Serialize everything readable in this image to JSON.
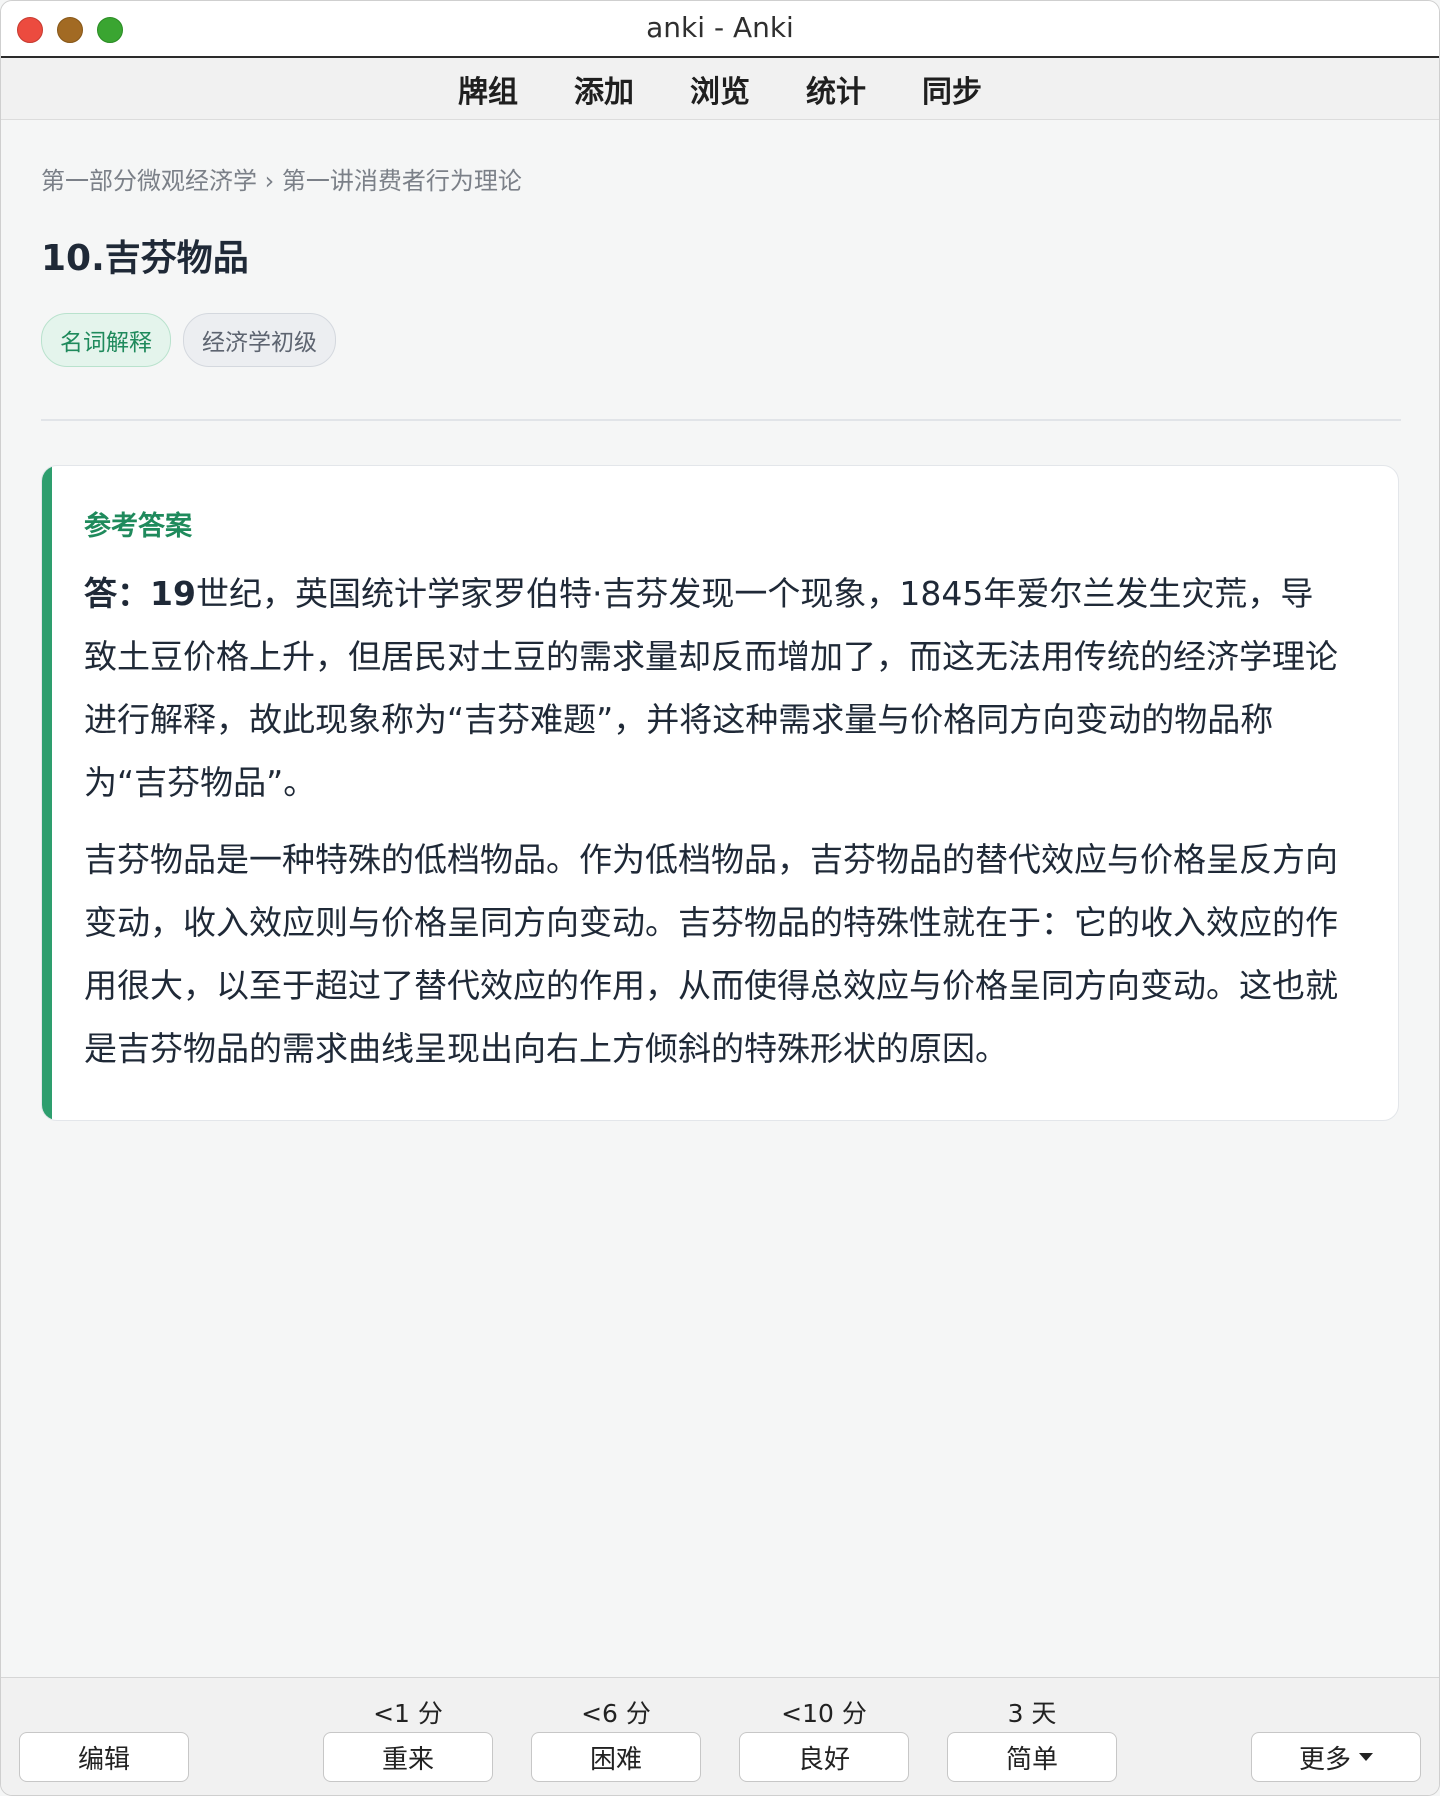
{
  "window": {
    "title": "anki - Anki"
  },
  "topnav": {
    "items": [
      "牌组",
      "添加",
      "浏览",
      "统计",
      "同步"
    ]
  },
  "breadcrumb": "第一部分微观经济学 › 第一讲消费者行为理论",
  "card": {
    "title": "10.吉芬物品",
    "tags": [
      "名词解释",
      "经济学初级"
    ],
    "answer_label": "参考答案",
    "answer_lead": "答：19",
    "answer_p1_rest": "世纪，英国统计学家罗伯特·吉芬发现一个现象，1845年爱尔兰发生灾荒，导致土豆价格上升，但居民对土豆的需求量却反而增加了，而这无法用传统的经济学理论进行解释，故此现象称为“吉芬难题”，并将这种需求量与价格同方向变动的物品称为“吉芬物品”。",
    "answer_p2": "吉芬物品是一种特殊的低档物品。作为低档物品，吉芬物品的替代效应与价格呈反方向变动，收入效应则与价格呈同方向变动。吉芬物品的特殊性就在于：它的收入效应的作用很大，以至于超过了替代效应的作用，从而使得总效应与价格呈同方向变动。这也就是吉芬物品的需求曲线呈现出向右上方倾斜的特殊形状的原因。"
  },
  "bottombar": {
    "edit_label": "编辑",
    "more_label": "更多",
    "answers": [
      {
        "label": "重来",
        "interval": "<1 分"
      },
      {
        "label": "困难",
        "interval": "<6 分"
      },
      {
        "label": "良好",
        "interval": "<10 分"
      },
      {
        "label": "简单",
        "interval": "3 天"
      }
    ]
  },
  "colors": {
    "accent": "#2e9e6e",
    "tag_green": "#1f8a5c"
  }
}
